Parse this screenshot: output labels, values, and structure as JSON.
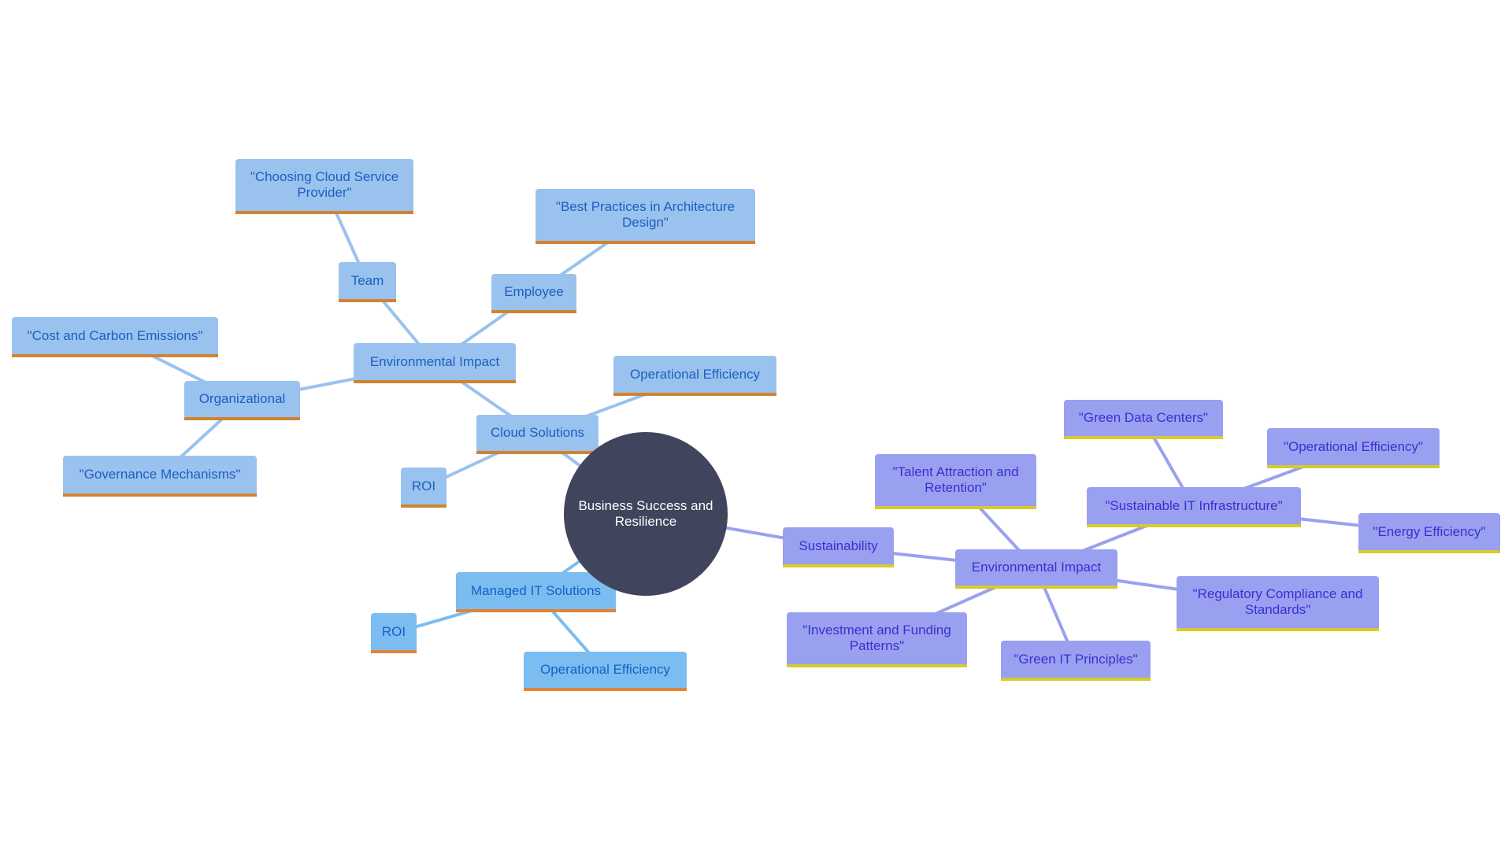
{
  "root": {
    "label": "Business Success and Resilience",
    "color": "#40445c"
  },
  "colors": {
    "blue_fill": "#9ac2ee",
    "blue_text": "#1c5fc0",
    "blue_border": "#d08430",
    "sky_fill": "#7bbdf0",
    "purple_fill": "#9aa0f0",
    "purple_text": "#3a2fcf",
    "purple_border": "#d6cc2a"
  },
  "nodes": [
    {
      "id": "cloud",
      "label": "Cloud Solutions",
      "parent": "root",
      "theme": "blue"
    },
    {
      "id": "env_blue",
      "label": "Environmental Impact",
      "parent": "cloud",
      "theme": "blue"
    },
    {
      "id": "opeff_blue",
      "label": "Operational Efficiency",
      "parent": "cloud",
      "theme": "blue"
    },
    {
      "id": "roi_blue",
      "label": "ROI",
      "parent": "cloud",
      "theme": "blue"
    },
    {
      "id": "team",
      "label": "Team",
      "parent": "env_blue",
      "theme": "blue"
    },
    {
      "id": "employee",
      "label": "Employee",
      "parent": "env_blue",
      "theme": "blue"
    },
    {
      "id": "org",
      "label": "Organizational",
      "parent": "env_blue",
      "theme": "blue"
    },
    {
      "id": "choosing",
      "label": "\"Choosing Cloud Service Provider\"",
      "parent": "team",
      "theme": "blue"
    },
    {
      "id": "best",
      "label": "\"Best Practices in Architecture Design\"",
      "parent": "employee",
      "theme": "blue"
    },
    {
      "id": "cost",
      "label": "\"Cost and Carbon Emissions\"",
      "parent": "org",
      "theme": "blue"
    },
    {
      "id": "gov",
      "label": "\"Governance Mechanisms\"",
      "parent": "org",
      "theme": "blue"
    },
    {
      "id": "managed",
      "label": "Managed IT Solutions",
      "parent": "root",
      "theme": "sky"
    },
    {
      "id": "roi_managed",
      "label": "ROI",
      "parent": "managed",
      "theme": "sky"
    },
    {
      "id": "opeff_managed",
      "label": "Operational Efficiency",
      "parent": "managed",
      "theme": "sky"
    },
    {
      "id": "sust",
      "label": "Sustainability",
      "parent": "root",
      "theme": "purple"
    },
    {
      "id": "env_purple",
      "label": "Environmental Impact",
      "parent": "sust",
      "theme": "purple"
    },
    {
      "id": "talent",
      "label": "\"Talent Attraction and Retention\"",
      "parent": "env_purple",
      "theme": "purple"
    },
    {
      "id": "sustit",
      "label": "\"Sustainable IT Infrastructure\"",
      "parent": "env_purple",
      "theme": "purple"
    },
    {
      "id": "regulatory",
      "label": "\"Regulatory Compliance and Standards\"",
      "parent": "env_purple",
      "theme": "purple"
    },
    {
      "id": "investment",
      "label": "\"Investment and Funding Patterns\"",
      "parent": "env_purple",
      "theme": "purple"
    },
    {
      "id": "greenit",
      "label": "\"Green IT Principles\"",
      "parent": "env_purple",
      "theme": "purple"
    },
    {
      "id": "greendc",
      "label": "\"Green Data Centers\"",
      "parent": "sustit",
      "theme": "purple"
    },
    {
      "id": "opeff_purple",
      "label": "\"Operational Efficiency\"",
      "parent": "sustit",
      "theme": "purple"
    },
    {
      "id": "energy",
      "label": "\"Energy Efficiency\"",
      "parent": "sustit",
      "theme": "purple"
    }
  ]
}
